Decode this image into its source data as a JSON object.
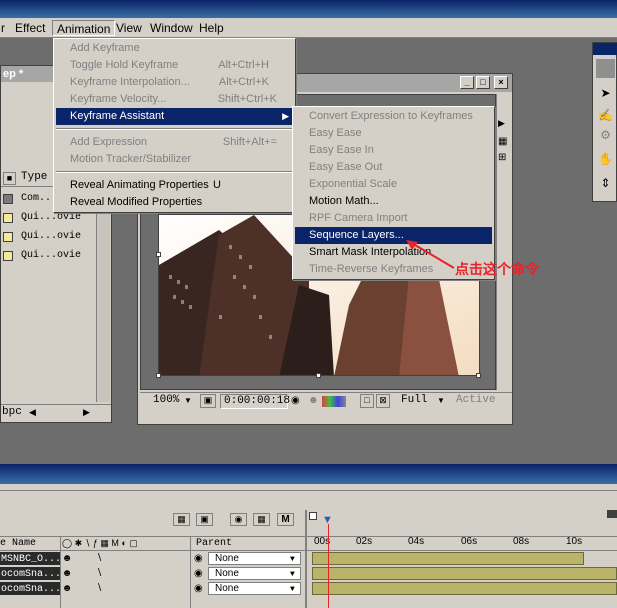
{
  "menubar": {
    "items": [
      "Effect",
      "Animation",
      "View",
      "Window",
      "Help"
    ],
    "partial_left": "r"
  },
  "project_panel": {
    "title": "ep *",
    "type_header": "Type",
    "rows": [
      {
        "type": "Com..",
        "color": "#7a7a7a"
      },
      {
        "type": "Qui...ovie",
        "color": "#f2e99a"
      },
      {
        "type": "Qui...ovie",
        "color": "#f2e99a"
      },
      {
        "type": "Qui...ovie",
        "color": "#f2e99a"
      }
    ],
    "bpc_label": "bpc"
  },
  "animation_menu": {
    "items": [
      {
        "label": "Add Keyframe",
        "shortcut": "",
        "disabled": true
      },
      {
        "label": "Toggle Hold Keyframe",
        "shortcut": "Alt+Ctrl+H",
        "disabled": true
      },
      {
        "label": "Keyframe Interpolation...",
        "shortcut": "Alt+Ctrl+K",
        "disabled": true
      },
      {
        "label": "Keyframe Velocity...",
        "shortcut": "Shift+Ctrl+K",
        "disabled": true
      },
      {
        "label": "Keyframe Assistant",
        "shortcut": "",
        "disabled": false,
        "highlight": true,
        "submenu": true
      },
      {
        "label": "Add Expression",
        "shortcut": "Shift+Alt+=",
        "disabled": true
      },
      {
        "label": "Motion Tracker/Stabilizer",
        "shortcut": "",
        "disabled": true
      },
      {
        "label": "Reveal Animating Properties",
        "shortcut": "U",
        "disabled": false
      },
      {
        "label": "Reveal Modified Properties",
        "shortcut": "",
        "disabled": false
      }
    ]
  },
  "keyframe_assistant_menu": {
    "items": [
      {
        "label": "Convert Expression to Keyframes",
        "disabled": true
      },
      {
        "label": "Easy Ease",
        "disabled": true
      },
      {
        "label": "Easy Ease In",
        "disabled": true
      },
      {
        "label": "Easy Ease Out",
        "disabled": true
      },
      {
        "label": "Exponential Scale",
        "disabled": true
      },
      {
        "label": "Motion Math...",
        "disabled": false
      },
      {
        "label": "RPF Camera Import",
        "disabled": true
      },
      {
        "label": "Sequence Layers...",
        "disabled": false,
        "highlight": true
      },
      {
        "label": "Smart Mask Interpolation",
        "disabled": false
      },
      {
        "label": "Time-Reverse Keyframes",
        "disabled": true
      }
    ]
  },
  "annotation": {
    "text": "点击这个命令",
    "color": "#e8232a"
  },
  "comp_footer": {
    "zoom": "100%",
    "timecode": "0:00:00:18",
    "resolution": "Full",
    "view": "Active"
  },
  "timeline": {
    "col_name": "e Name",
    "col_parent": "Parent",
    "ticks": [
      "00s",
      "02s",
      "04s",
      "06s",
      "08s",
      "10s"
    ],
    "layers": [
      {
        "name": "MSNBC_O...",
        "parent": "None"
      },
      {
        "name": "ocomSna...",
        "parent": "None"
      },
      {
        "name": "ocomSna...",
        "parent": "None"
      }
    ],
    "switch_letter": "M"
  }
}
